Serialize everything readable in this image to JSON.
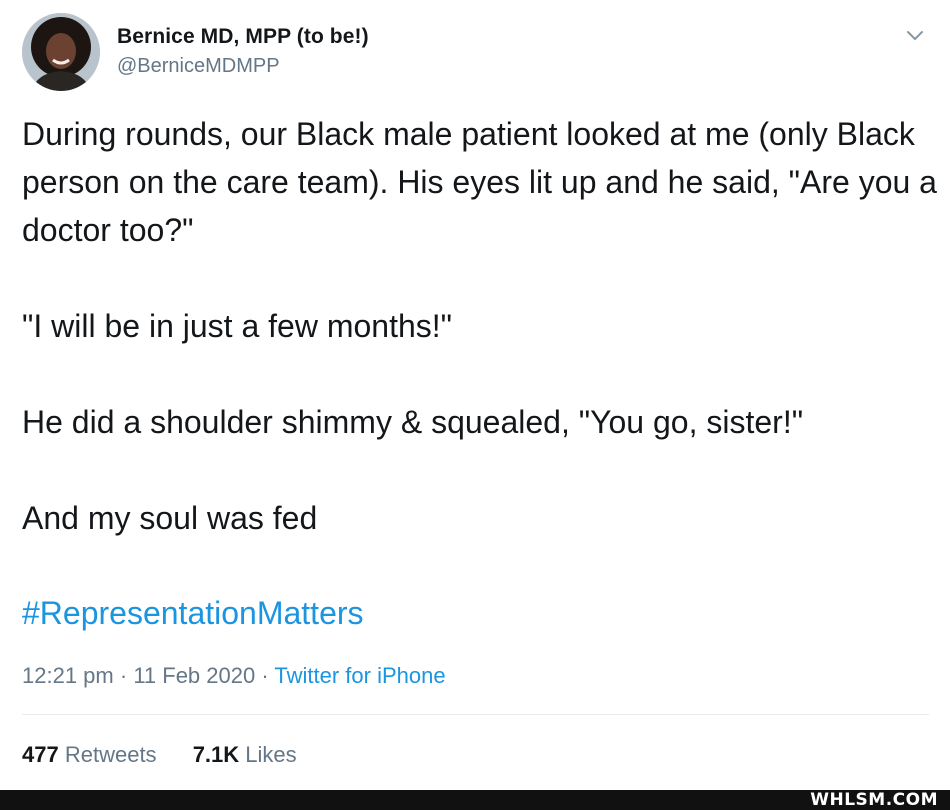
{
  "author": {
    "display_name": "Bernice MD, MPP (to be!)",
    "handle": "@BerniceMDMPP",
    "avatar_icon": "profile-photo"
  },
  "menu": {
    "icon": "chevron-down-icon"
  },
  "tweet": {
    "paragraphs": [
      "During rounds, our Black male patient looked at me (only Black person on the care team). His eyes lit up and he said, \"Are you a doctor too?\"",
      "\"I will be in just a few months!\"",
      "He did a shoulder shimmy & squealed, \"You go, sister!\"",
      "And my soul was fed"
    ],
    "hashtag": "#RepresentationMatters",
    "time": "12:21 pm",
    "date": "11 Feb 2020",
    "separator": "·",
    "source": "Twitter for iPhone"
  },
  "stats": {
    "retweets_count": "477",
    "retweets_label": "Retweets",
    "likes_count": "7.1K",
    "likes_label": "Likes"
  },
  "watermark": "WHLSM.COM",
  "colors": {
    "link": "#1b95e0",
    "text": "#14171a",
    "muted": "#657786",
    "divider": "#e6ecf0"
  }
}
